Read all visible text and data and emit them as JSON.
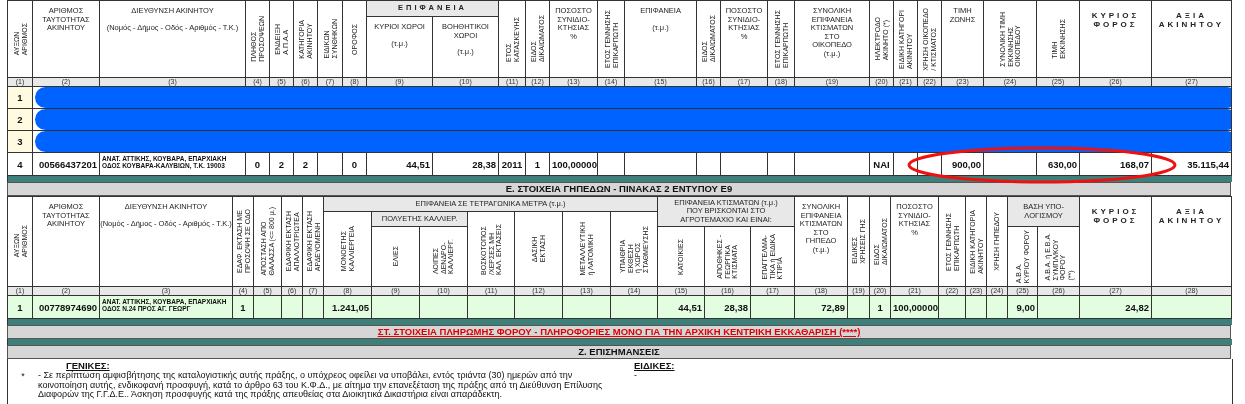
{
  "property_table": {
    "highlight_ellipse": true,
    "columns": [
      {
        "kind": "vertical",
        "text": [
          "ΑΥΞΩΝ",
          "ΑΡΙΘΜΟΣ"
        ],
        "num": "(1)"
      },
      {
        "kind": "plain",
        "text": [
          "ΑΡΙΘΜΟΣ",
          "ΤΑΥΤΟΤΗΤΑΣ",
          "ΑΚΙΝΗΤΟΥ"
        ],
        "num": "(2)"
      },
      {
        "kind": "plain",
        "text": [
          "ΔΙΕΥΘΥΝΣΗ ΑΚΙΝΗΤΟΥ"
        ],
        "sub": "(Νομός - Δήμος - Οδός - Αριθμός - Τ.Κ.)",
        "num": "(3)"
      },
      {
        "kind": "vertical",
        "text": [
          "ΠΛΗΘΟΣ",
          "ΠΡΟΣΟΨΕΩΝ"
        ],
        "num": "(4)"
      },
      {
        "kind": "vertical",
        "text": [
          "ΕΝΔΕΙΞΗ",
          "Α.Π.Α.Α"
        ],
        "num": "(5)"
      },
      {
        "kind": "vertical",
        "text": [
          "ΚΑΤΗΓΟΡΙΑ",
          "ΑΚΙΝΗΤΟΥ"
        ],
        "num": "(6)"
      },
      {
        "kind": "vertical",
        "text": [
          "ΕΙΔΙΚΩΝ",
          "ΣΥΝΘΗΚΩΝ"
        ],
        "num": "(7)"
      },
      {
        "kind": "vertical",
        "text": [
          "ΟΡΟΦΟΣ"
        ],
        "num": "(8)"
      },
      {
        "kind": "group-spaced",
        "text": [
          "ΕΠΙΦΑΝΕΙΑ"
        ],
        "children": [
          {
            "kind": "plain",
            "text": [
              "ΚΥΡΙΟΙ ΧΩΡΟΙ"
            ],
            "sub": "(τ.μ.)",
            "num": "(9)"
          },
          {
            "kind": "plain",
            "text": [
              "ΒΟΗΘΗΤΙΚΟΙ",
              "ΧΩΡΟΙ"
            ],
            "sub": "(τ.μ.)",
            "num": "(10)"
          }
        ]
      },
      {
        "kind": "vertical",
        "text": [
          "ΕΤΟΣ",
          "ΚΑΤΑΣΚΕΥΗΣ"
        ],
        "num": "(11)"
      },
      {
        "kind": "vertical",
        "text": [
          "ΕΙΔΟΣ",
          "ΔΙΚΑΙΩΜΑΤΟΣ"
        ],
        "num": "(12)"
      },
      {
        "kind": "plain",
        "text": [
          "ΠΟΣΟΣΤΟ",
          "ΣΥΝΙΔΙΟ-",
          "ΚΤΗΣΙΑΣ",
          "%"
        ],
        "num": "(13)"
      },
      {
        "kind": "vertical",
        "text": [
          "ΕΤΟΣ ΓΕΝΝΗΣΗΣ",
          "ΕΠΙΚΑΡΠΩΤΗ"
        ],
        "num": "(14)"
      },
      {
        "kind": "plain",
        "text": [
          "ΕΠΙΦΑΝΕΙΑ"
        ],
        "sub": "(τ.μ.)",
        "num": "(15)"
      },
      {
        "kind": "vertical",
        "text": [
          "ΕΙΔΟΣ",
          "ΔΙΚΑΙΩΜΑΤΟΣ"
        ],
        "num": "(16)"
      },
      {
        "kind": "plain",
        "text": [
          "ΠΟΣΟΣΤΟ",
          "ΣΥΝΙΔΙΟ-",
          "ΚΤΗΣΙΑΣ",
          "%"
        ],
        "num": "(17)"
      },
      {
        "kind": "vertical",
        "text": [
          "ΕΤΟΣ ΓΕΝΝΗΣΗΣ",
          "ΕΠΙΚΑΡΠΩΤΗ"
        ],
        "num": "(18)"
      },
      {
        "kind": "plain",
        "text": [
          "ΣΥΝΟΛΙΚΗ",
          "ΕΠΙΦΑΝΕΙΑ",
          "ΚΤΙΣΜΑΤΩΝ",
          "ΣΤΟ",
          "ΟΙΚΟΠΕΔΟ",
          "(τ.μ.)"
        ],
        "num": "(19)"
      },
      {
        "kind": "vertical",
        "text": [
          "ΗΛΕΚΤΡΟΔΟ",
          "ΑΚΙΝΗΤΟ (*)"
        ],
        "num": "(20)"
      },
      {
        "kind": "vertical",
        "text": [
          "ΕΙΔΙΚΗ ΚΑΤΗΓΟΡΙ",
          "ΑΚΙΝΗΤΟΥ"
        ],
        "num": "(21)"
      },
      {
        "kind": "vertical",
        "text": [
          "ΧΡΗΣΗ ΟΙΚΟΠΕΔΟ",
          "/ ΚΤΙΣΜΑΤΟΣ"
        ],
        "num": "(22)"
      },
      {
        "kind": "plain",
        "text": [
          "ΤΙΜΗ",
          "ΖΩΝΗΣ"
        ],
        "num": "(23)"
      },
      {
        "kind": "vertical",
        "text": [
          "ΣΥΝΟΛΙΚΗ ΤΙΜΗ",
          "ΕΚΚΙΝΗΣΗΣ",
          "ΟΙΚΟΠΕΔΟΥ"
        ],
        "num": "(24)"
      },
      {
        "kind": "vertical",
        "text": [
          "ΤΙΜΗ",
          "ΕΚΚΙΝΗΣΗΣ"
        ],
        "num": "(25)"
      },
      {
        "kind": "spaced",
        "text": [
          "ΚΥΡΙΟΣ",
          "ΦΟΡΟΣ"
        ],
        "num": "(26)"
      },
      {
        "kind": "spaced",
        "text": [
          "ΑΞΙΑ",
          "ΑΚΙΝΗΤΟΥ"
        ],
        "num": "(27)"
      }
    ],
    "rows": [
      {
        "redacted": true,
        "cells": {
          "1": "1"
        }
      },
      {
        "redacted": true,
        "cells": {
          "1": "2"
        }
      },
      {
        "redacted": true,
        "cells": {
          "1": "3"
        }
      },
      {
        "redacted": false,
        "cells": {
          "1": "4",
          "2": "00566437201",
          "3": "ΑΝΑΤ. ΑΤΤΙΚΗΣ, ΚΟΥΒΑΡΑ, ΕΠΑΡΧΙΑΚΗ ΟΔΟΣ ΚΟΥΒΑΡΑ-ΚΑΛΥΒΙΩΝ, Τ.Κ. 19003",
          "4": "0",
          "5": "2",
          "6": "2",
          "8": "0",
          "9": "44,51",
          "10": "28,38",
          "11": "2011",
          "12": "1",
          "13": "100,00000",
          "20": "ΝΑΙ",
          "23": "900,00",
          "25": "630,00",
          "26": "168,07",
          "27": "35.115,44"
        }
      }
    ]
  },
  "land_section": {
    "title": "Ε. ΣΤΟΙΧΕΙΑ ΓΗΠΕΔΩΝ - ΠΙΝΑΚΑΣ 2 ΕΝΤΥΠΟΥ Ε9"
  },
  "land_table": {
    "columns": [
      {
        "kind": "vertical",
        "text": [
          "ΑΥΞΩΝ",
          "ΑΡΙΘΜΟΣ"
        ],
        "num": "(1)"
      },
      {
        "kind": "plain",
        "text": [
          "ΑΡΙΘΜΟΣ",
          "ΤΑΥΤΟΤΗΤΑΣ",
          "ΑΚΙΝΗΤΟΥ"
        ],
        "num": "(2)"
      },
      {
        "kind": "plain",
        "text": [
          "ΔΙΕΥΘΥΝΣΗ ΑΚΙΝΗΤΟΥ"
        ],
        "sub": "(Νομός - Δήμος - Οδός - Αριθμός - Τ.Κ.)",
        "num": "(3)"
      },
      {
        "kind": "vertical",
        "text": [
          "ΕΔΑΦ. ΕΚΤΑΣΗ ΜΕ",
          "ΠΡΟΣΟΨΗ ΣΕ ΟΔΟ"
        ],
        "num": "(4)"
      },
      {
        "kind": "vertical",
        "text": [
          "ΑΠΟΣΤΑΣΗ ΑΠΟ",
          "ΘΑΛΑΣΣΑ (<= 800 μ.)"
        ],
        "num": "(5)"
      },
      {
        "kind": "vertical",
        "text": [
          "ΕΔΑΦΙΚΗ ΕΚΤΑΣΗ",
          "ΑΠΑΛΛΟΤΡΙΩΤΕΑ"
        ],
        "num": "(6)"
      },
      {
        "kind": "vertical",
        "text": [
          "ΕΔΑΦΙΚΗ ΕΚΤΑΣΗ",
          "ΑΡΔΕΥΟΜΕΝΗ"
        ],
        "num": "(7)"
      },
      {
        "kind": "group",
        "text": [
          "ΕΠΙΦΑΝΕΙΑ ΣΕ ΤΕΤΡΑΓΩΝΙΚΑ ΜΕΤΡΑ (τ.μ.)"
        ],
        "children": [
          {
            "kind": "vertical",
            "text": [
              "ΜΟΝΟΕΤΗΣ",
              "ΚΑΛΛΙΕΡΓΕΙΑ"
            ],
            "num": "(8)"
          },
          {
            "kind": "group",
            "text": [
              "ΠΟΛΥΕΤΗΣ ΚΑΛΛΙΕΡ."
            ],
            "children": [
              {
                "kind": "vertical",
                "text": [
                  "ΕΛΙΕΣ"
                ],
                "num": "(9)"
              },
              {
                "kind": "vertical",
                "text": [
                  "ΛΟΙΠΕΣ",
                  "ΔΕΝΔΡΟ-",
                  "ΚΑΛΛΙΕΡΓ."
                ],
                "num": "(10)"
              }
            ]
          },
          {
            "kind": "vertical",
            "text": [
              "ΒΟΣΚΟΤΟΠΟΣ",
              "/ΧΕΡΣΕΣ ΜΗ",
              "ΚΑΛ. ΕΚΤΑΣΕΙΣ"
            ],
            "num": "(11)"
          },
          {
            "kind": "vertical",
            "text": [
              "ΔΑΣΙΚΗ",
              "ΕΚΤΑΣΗ"
            ],
            "num": "(12)"
          },
          {
            "kind": "vertical",
            "text": [
              "ΜΕΤΑΛΛΕΥΤΙΚΗ",
              "ή ΛΑΤΟΜΙΚΗ"
            ],
            "num": "(13)"
          },
          {
            "kind": "vertical",
            "text": [
              "ΥΠΑΙΘΡΙΑ",
              "ΕΚΘΕΣΗ",
              "ή ΧΩΡΟΣ",
              "ΣΤΑΘΜΕΥΣΗΣ"
            ],
            "num": "(14)"
          }
        ]
      },
      {
        "kind": "group",
        "text": [
          "ΕΠΙΦΑΝΕΙΑ ΚΤΙΣΜΑΤΩΝ (τ.μ.)",
          "ΠΟΥ ΒΡΙΣΚΟΝΤΑΙ ΣΤΟ",
          "ΑΓΡΟΤΕΜΑΧΙΟ ΚΑΙ ΕΙΝΑΙ:"
        ],
        "children": [
          {
            "kind": "vertical",
            "text": [
              "ΚΑΤΟΙΚΙΕΣ"
            ],
            "num": "(15)"
          },
          {
            "kind": "vertical",
            "text": [
              "ΑΠΟΘΗΚΕΣ -",
              "ΓΕΩΡΓΙΚΑ",
              "ΚΤΙΣΜΑΤΑ"
            ],
            "num": "(16)"
          },
          {
            "kind": "vertical",
            "text": [
              "ΕΠΑΓΓΕΛΜΑ-",
              "ΤΙΚΑ ή ΕΙΔΙΚΑ",
              "ΚΤΙΡΙΑ"
            ],
            "num": "(17)"
          }
        ]
      },
      {
        "kind": "plain",
        "text": [
          "ΣΥΝΟΛΙΚΗ",
          "ΕΠΙΦΑΝΕΙΑ",
          "ΚΤΙΣΜΑΤΩΝ",
          "ΣΤΟ",
          "ΓΗΠΕΔΟ",
          "(τ.μ.)"
        ],
        "num": "(18)"
      },
      {
        "kind": "vertical",
        "text": [
          "ΕΙΔΙΚΕΣ",
          "ΧΡΗΣΕΙΣ ΓΗΣ"
        ],
        "num": "(19)"
      },
      {
        "kind": "vertical",
        "text": [
          "ΕΙΔΟΣ",
          "ΔΙΚΑΙΩΜΑΤΟΣ"
        ],
        "num": "(20)"
      },
      {
        "kind": "plain",
        "text": [
          "ΠΟΣΟΣΤΟ",
          "ΣΥΝΙΔΙΟ-",
          "ΚΤΗΣΙΑΣ",
          "%"
        ],
        "num": "(21)"
      },
      {
        "kind": "vertical",
        "text": [
          "ΕΤΟΣ ΓΕΝΝΗΣΗΣ",
          "ΕΠΙΚΑΡΠΩΤΗ"
        ],
        "num": "(22)"
      },
      {
        "kind": "vertical",
        "text": [
          "ΕΙΔΙΚΗ ΚΑΤΗΓΟΡΙΑ",
          "ΑΚΙΝΗΤΟΥ"
        ],
        "num": "(23)"
      },
      {
        "kind": "vertical",
        "text": [
          "ΧΡΗΣΗ ΓΗΠΕΔΟΥ"
        ],
        "num": "(24)"
      },
      {
        "kind": "group",
        "text": [
          "ΒΑΣΗ ΥΠΟ-",
          "ΛΟΓΙΣΜΟΥ"
        ],
        "children": [
          {
            "kind": "vertical",
            "text": [
              "Α.Β.Α.",
              "ΚΥΡΙΟΥ ΦΟΡΟΥ"
            ],
            "num": "(25)"
          },
          {
            "kind": "vertical",
            "text": [
              "Α.Β.Α. ή Ε.Β.Α.",
              "ΣΥΜΠΛ/ΚΟΥ",
              "ΦΟΡΟΥ",
              "(**)"
            ],
            "num": "(26)"
          }
        ]
      },
      {
        "kind": "spaced",
        "text": [
          "ΚΥΡΙΟΣ",
          "ΦΟΡΟΣ"
        ],
        "num": "(27)"
      },
      {
        "kind": "spaced",
        "text": [
          "ΑΞΙΑ",
          "ΑΚΙΝΗΤΟΥ"
        ],
        "num": "(28)"
      }
    ],
    "rows": [
      {
        "redacted": false,
        "cells": {
          "1": "1",
          "2": "00778974690",
          "3": "ΑΝΑΤ. ΑΤΤΙΚΗΣ, ΚΟΥΒΑΡΑ, ΕΠΑΡΧΙΑΚΗ ΟΔΟΣ Ν.24 ΠΡΟΣ ΑΓ. ΓΕΩΡΓ",
          "4": "1",
          "8": "1.241,05",
          "15": "44,51",
          "16": "28,38",
          "18": "72,89",
          "20": "1",
          "21": "100,00000",
          "25": "9,00",
          "27": "24,82"
        }
      }
    ]
  },
  "payment_section": {
    "title": "ΣΤ. ΣΤΟΙΧΕΙΑ ΠΛΗΡΩΜΗΣ ΦΟΡΟΥ - ΠΛΗΡΟΦΟΡΙΕΣ ΜΟΝΟ ΓΙΑ ΤΗΝ ΑΡΧΙΚΗ ΚΕΝΤΡΙΚΗ ΕΚΚΑΘΑΡΙΣΗ (****)"
  },
  "notes_section": {
    "title": "Ζ. ΕΠΙΣΗΜΑΝΣΕΙΣ",
    "general": {
      "heading": "ΓΕΝΙΚΕΣ:",
      "marker": "*",
      "text": "- Σε περίπτωση αμφισβήτησης της καταλογιστικής αυτής πράξης, ο υπόχρεος οφείλει να υποβάλει, εντός τριάντα (30) ημερών από την κοινοποίηση αυτής, ενδικοφανή προσφυγή, κατά το άρθρο 63 του Κ.Φ.Δ., με αίτημα την επανεξέταση της πράξης από τη Διεύθυνση Επίλυσης Διαφορών της Γ.Γ.Δ.Ε.. Άσκηση προσφυγής κατά της πράξης απευθείας στα Διοικητικά Δικαστήρια είναι απαράδεκτη."
    },
    "specific": {
      "heading": "ΕΙΔΙΚΕΣ:",
      "text": "-"
    }
  }
}
